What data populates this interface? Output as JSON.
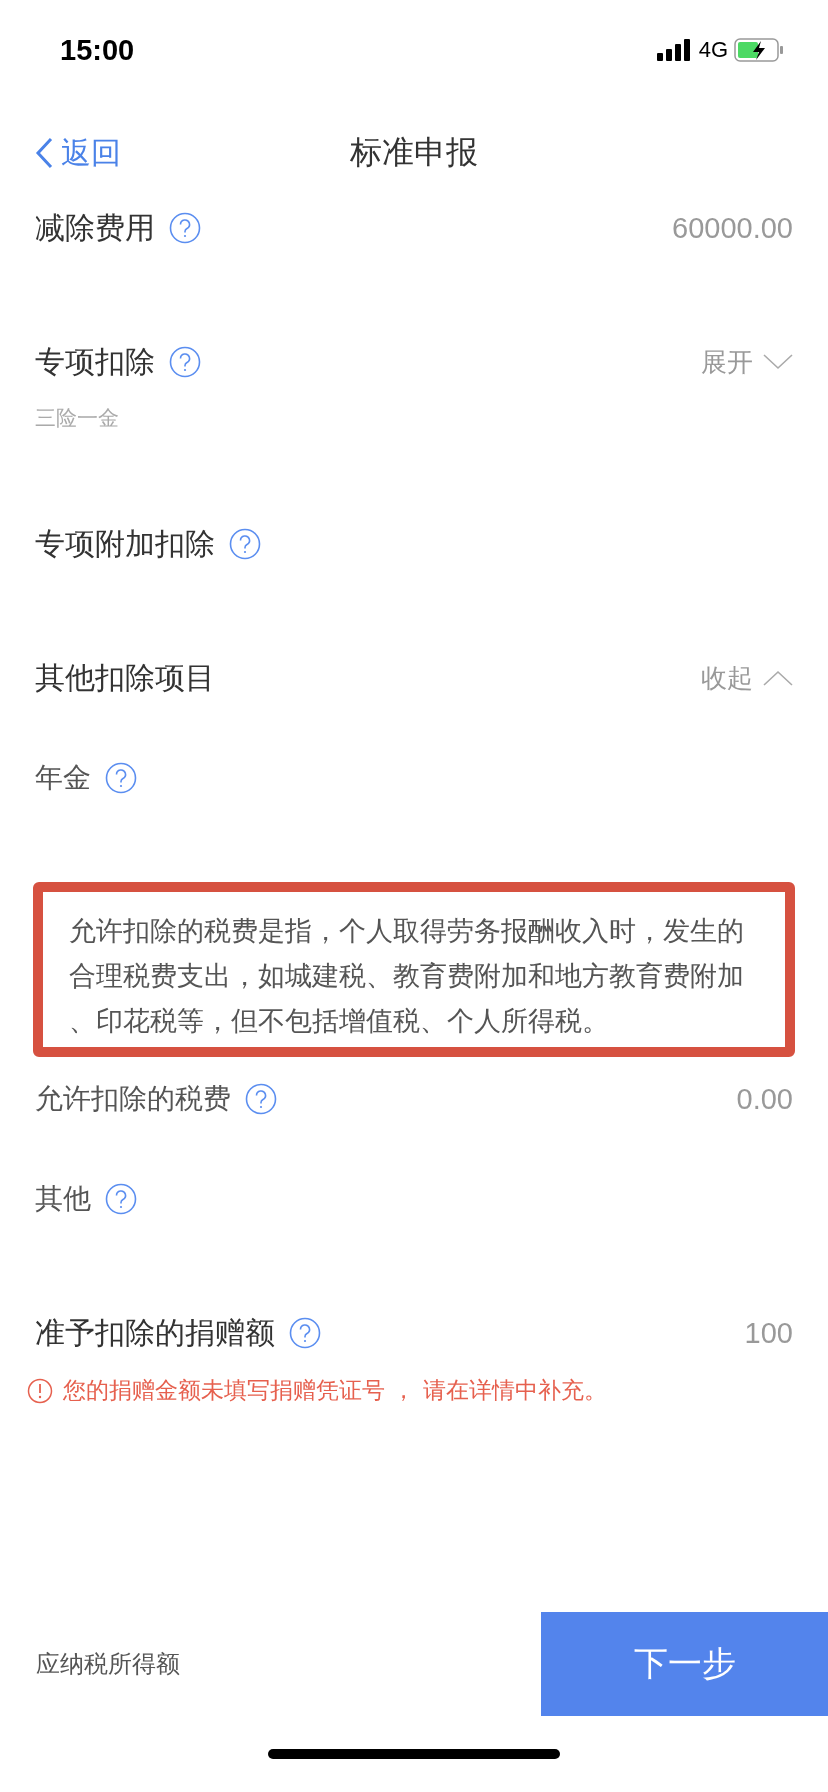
{
  "status_bar": {
    "time": "15:00",
    "network": "4G"
  },
  "nav": {
    "back": "返回",
    "title": "标准申报"
  },
  "rows": [
    {
      "kind": "header",
      "label": "减除费用",
      "help": true,
      "value": "60000.00"
    },
    {
      "kind": "header",
      "label": "专项扣除",
      "help": true,
      "sub": "三险一金",
      "toggle": {
        "label": "展开",
        "expanded": false
      }
    },
    {
      "kind": "header",
      "label": "专项附加扣除",
      "help": true
    },
    {
      "kind": "header",
      "label": "其他扣除项目",
      "help": false,
      "toggle": {
        "label": "收起",
        "expanded": true
      }
    },
    {
      "kind": "item",
      "label": "年金",
      "help": true
    },
    {
      "kind": "tooltip",
      "text": "允许扣除的税费是指，个人取得劳务报酬收入时，发生的合理税费支出，如城建税、教育费附加和地方教育费附加、印花税等，但不包括增值税、个人所得税。"
    },
    {
      "kind": "item",
      "label": "允许扣除的税费",
      "help": true,
      "value": "0.00"
    },
    {
      "kind": "item",
      "label": "其他",
      "help": true
    },
    {
      "kind": "header",
      "label": "准予扣除的捐赠额",
      "help": true,
      "value": "100",
      "warning": "您的捐赠金额未填写捐赠凭证号 ， 请在详情中补充。"
    }
  ],
  "footer": {
    "label": "应纳税所得额",
    "button": "下一步"
  }
}
